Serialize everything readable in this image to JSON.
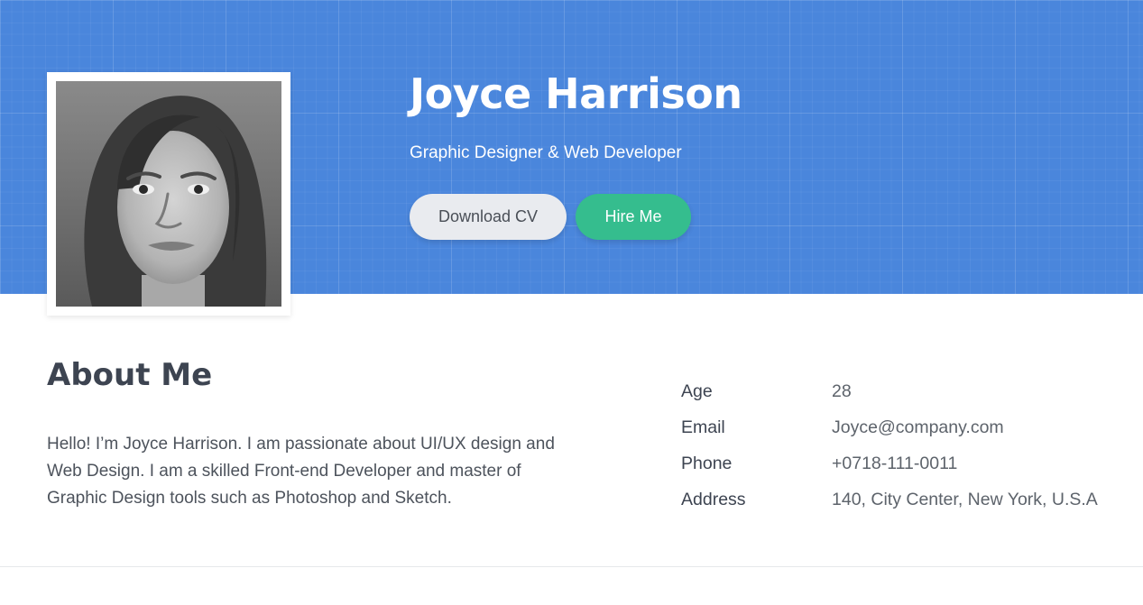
{
  "profile": {
    "name": "Joyce Harrison",
    "role": "Graphic Designer & Web Developer",
    "photo_icon": "portrait-photo"
  },
  "buttons": {
    "download_cv": "Download CV",
    "hire_me": "Hire Me"
  },
  "about": {
    "title": "About Me",
    "text": "Hello! I’m Joyce Harrison. I am passionate about UI/UX design and Web Design. I am a skilled Front-end Developer and master of Graphic Design tools such as Photoshop and Sketch."
  },
  "info": [
    {
      "label": "Age",
      "value": "28"
    },
    {
      "label": "Email",
      "value": "Joyce@company.com"
    },
    {
      "label": "Phone",
      "value": "+0718-111-0011"
    },
    {
      "label": "Address",
      "value": "140, City Center, New York, U.S.A"
    }
  ],
  "colors": {
    "hero_bg": "#4a86dc",
    "hire_button": "#35bd8e",
    "cv_button": "#e9ebef",
    "heading": "#3d4451"
  }
}
